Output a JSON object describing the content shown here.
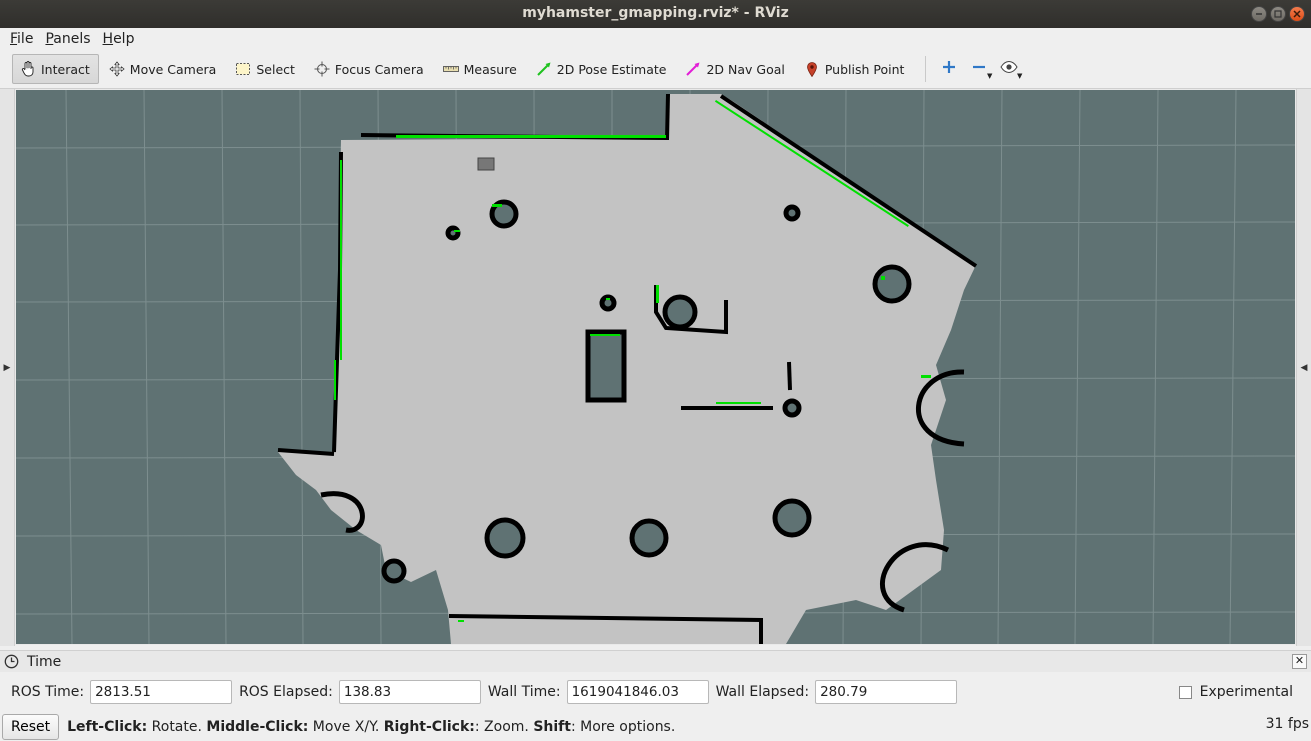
{
  "window": {
    "title": "myhamster_gmapping.rviz* - RViz"
  },
  "menu": [
    {
      "label": "File",
      "mnemonic": "F",
      "rest": "ile"
    },
    {
      "label": "Panels",
      "mnemonic": "P",
      "rest": "anels"
    },
    {
      "label": "Help",
      "mnemonic": "H",
      "rest": "elp"
    }
  ],
  "toolbar": {
    "interact": "Interact",
    "move_camera": "Move Camera",
    "select": "Select",
    "focus_camera": "Focus Camera",
    "measure": "Measure",
    "pose_estimate": "2D Pose Estimate",
    "nav_goal": "2D Nav Goal",
    "publish_point": "Publish Point",
    "icons": {
      "interact": "hand-pointer-icon",
      "move_camera": "move-arrows-icon",
      "select": "selection-rect-icon",
      "focus_camera": "crosshair-icon",
      "measure": "ruler-icon",
      "pose_estimate": "green-arrow-icon",
      "nav_goal": "magenta-arrow-icon",
      "publish_point": "map-pin-icon",
      "add": "plus-icon",
      "remove": "minus-icon",
      "view": "eye-icon"
    }
  },
  "map": {
    "background": "#5f7273",
    "free_space": "#c3c3c3",
    "obstacle": "#000000",
    "laser_color": "#00e000"
  },
  "time_panel": {
    "title": "Time",
    "ros_time_label": "ROS Time:",
    "ros_time": "2813.51",
    "ros_elapsed_label": "ROS Elapsed:",
    "ros_elapsed": "138.83",
    "wall_time_label": "Wall Time:",
    "wall_time": "1619041846.03",
    "wall_elapsed_label": "Wall Elapsed:",
    "wall_elapsed": "280.79",
    "experimental_label": "Experimental",
    "experimental_checked": false
  },
  "status": {
    "reset": "Reset",
    "left_click_key": "Left-Click:",
    "left_click_desc": " Rotate. ",
    "middle_click_key": "Middle-Click:",
    "middle_click_desc": " Move X/Y. ",
    "right_click_key": "Right-Click:",
    "right_click_desc": ": Zoom. ",
    "shift_key": "Shift",
    "shift_desc": ": More options.",
    "fps": "31 fps"
  }
}
